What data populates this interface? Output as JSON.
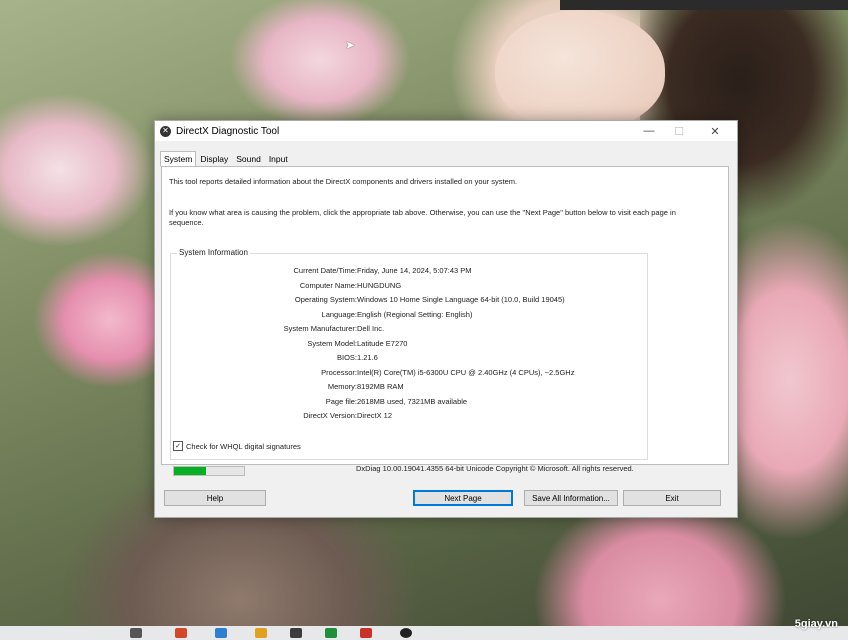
{
  "window": {
    "title": "DirectX Diagnostic Tool",
    "icon": "directx-icon"
  },
  "tabs": [
    {
      "label": "System",
      "active": true
    },
    {
      "label": "Display",
      "active": false
    },
    {
      "label": "Sound",
      "active": false
    },
    {
      "label": "Input",
      "active": false
    }
  ],
  "intro": {
    "line1": "This tool reports detailed information about the DirectX components and drivers installed on your system.",
    "line2": "If you know what area is causing the problem, click the appropriate tab above.  Otherwise, you can use the \"Next Page\" button below to visit each page in sequence."
  },
  "system_info": {
    "title": "System Information",
    "rows": [
      {
        "label": "Current Date/Time:",
        "value": "Friday, June 14, 2024, 5:07:43 PM"
      },
      {
        "label": "Computer Name:",
        "value": "HUNGDUNG"
      },
      {
        "label": "Operating System:",
        "value": "Windows 10 Home Single Language 64-bit (10.0, Build 19045)"
      },
      {
        "label": "Language:",
        "value": "English (Regional Setting: English)"
      },
      {
        "label": "System Manufacturer:",
        "value": "Dell Inc."
      },
      {
        "label": "System Model:",
        "value": "Latitude E7270"
      },
      {
        "label": "BIOS:",
        "value": "1.21.6"
      },
      {
        "label": "Processor:",
        "value": "Intel(R) Core(TM) i5-6300U CPU @ 2.40GHz (4 CPUs), ~2.5GHz"
      },
      {
        "label": "Memory:",
        "value": "8192MB RAM"
      },
      {
        "label": "Page file:",
        "value": "2618MB used, 7321MB available"
      },
      {
        "label": "DirectX Version:",
        "value": "DirectX 12"
      }
    ]
  },
  "whql": {
    "label": "Check for WHQL digital signatures",
    "checked": true
  },
  "progress": {
    "fraction": 0.45,
    "color": "#06b025"
  },
  "footer": {
    "text": "DxDiag 10.00.19041.4355 64-bit Unicode  Copyright © Microsoft. All rights reserved."
  },
  "buttons": {
    "help": "Help",
    "next": "Next Page",
    "save": "Save All Information...",
    "exit": "Exit"
  },
  "watermark": "5giay.vn"
}
